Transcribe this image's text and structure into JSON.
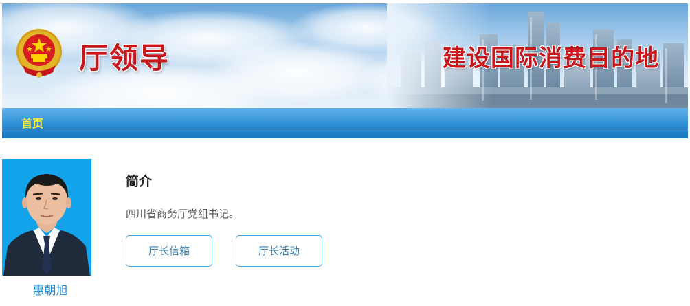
{
  "header": {
    "title": "厅领导",
    "slogan": "建设国际消费目的地",
    "emblem_icon": "national-emblem-icon"
  },
  "nav": {
    "home_label": "首页"
  },
  "profile": {
    "name": "惠朝旭",
    "intro_heading": "简介",
    "intro_text": "四川省商务厅党组书记。",
    "buttons": {
      "mailbox_label": "厅长信箱",
      "activities_label": "厅长活动"
    },
    "photo_background": "#12a3ea"
  },
  "colors": {
    "title_red": "#c8161d",
    "nav_blue": "#2e8fd5",
    "nav_home_yellow": "#ffee3a",
    "accent_blue": "#1e8ad2"
  }
}
